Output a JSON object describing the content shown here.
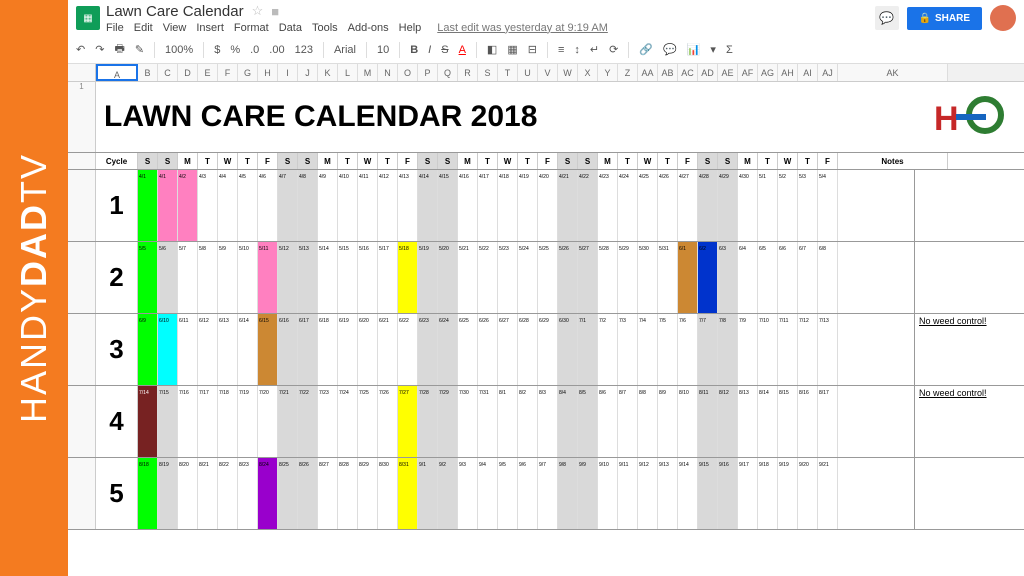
{
  "watermark": {
    "p1": "HANDY",
    "p2": "DAD",
    "p3": "TV"
  },
  "header": {
    "title": "Lawn Care Calendar",
    "menus": [
      "File",
      "Edit",
      "View",
      "Insert",
      "Format",
      "Data",
      "Tools",
      "Add-ons",
      "Help"
    ],
    "last_edit": "Last edit was yesterday at 9:19 AM",
    "share": "SHARE"
  },
  "toolbar": {
    "zoom": "100%",
    "currency": "$",
    "percent": "%",
    "dec0": ".0",
    "dec00": ".00",
    "fmt": "123",
    "font": "Arial",
    "size": "10"
  },
  "columns": [
    "A",
    "B",
    "C",
    "D",
    "E",
    "F",
    "G",
    "H",
    "I",
    "J",
    "K",
    "L",
    "M",
    "N",
    "O",
    "P",
    "Q",
    "R",
    "S",
    "T",
    "U",
    "V",
    "W",
    "X",
    "Y",
    "Z",
    "AA",
    "AB",
    "AC",
    "AD",
    "AE",
    "AF",
    "AG",
    "AH",
    "AI",
    "AJ",
    "AK"
  ],
  "sheet": {
    "title": "LAWN CARE CALENDAR 2018",
    "header_cycle": "Cycle",
    "header_days": [
      "S",
      "S",
      "M",
      "T",
      "W",
      "T",
      "F",
      "S",
      "S",
      "M",
      "T",
      "W",
      "T",
      "F",
      "S",
      "S",
      "M",
      "T",
      "W",
      "T",
      "F",
      "S",
      "S",
      "M",
      "T",
      "W",
      "T",
      "F",
      "S",
      "S",
      "M",
      "T",
      "W",
      "T",
      "F"
    ],
    "header_notes": "Notes",
    "weekend_cols": [
      0,
      1,
      7,
      8,
      14,
      15,
      21,
      22,
      28,
      29
    ],
    "cycles": [
      {
        "num": "1",
        "dates": [
          "4/1",
          "4/1",
          "4/2",
          "4/3",
          "4/4",
          "4/5",
          "4/6",
          "4/7",
          "4/8",
          "4/9",
          "4/10",
          "4/11",
          "4/12",
          "4/13",
          "4/14",
          "4/15",
          "4/16",
          "4/17",
          "4/18",
          "4/19",
          "4/20",
          "4/21",
          "4/22",
          "4/23",
          "4/24",
          "4/25",
          "4/26",
          "4/27",
          "4/28",
          "4/29",
          "4/30",
          "5/1",
          "5/2",
          "5/3",
          "5/4"
        ],
        "colors": {
          "0": "c-green",
          "1": "c-pink",
          "2": "c-pink"
        },
        "note": ""
      },
      {
        "num": "2",
        "dates": [
          "5/5",
          "5/6",
          "5/7",
          "5/8",
          "5/9",
          "5/10",
          "5/11",
          "5/12",
          "5/13",
          "5/14",
          "5/15",
          "5/16",
          "5/17",
          "5/18",
          "5/19",
          "5/20",
          "5/21",
          "5/22",
          "5/23",
          "5/24",
          "5/25",
          "5/26",
          "5/27",
          "5/28",
          "5/29",
          "5/30",
          "5/31",
          "6/1",
          "6/2",
          "6/3",
          "6/4",
          "6/5",
          "6/6",
          "6/7",
          "6/8"
        ],
        "colors": {
          "0": "c-green",
          "6": "c-pink",
          "13": "c-yellow",
          "27": "c-brown",
          "28": "c-blue"
        },
        "note": ""
      },
      {
        "num": "3",
        "dates": [
          "6/9",
          "6/10",
          "6/11",
          "6/12",
          "6/13",
          "6/14",
          "6/15",
          "6/16",
          "6/17",
          "6/18",
          "6/19",
          "6/20",
          "6/21",
          "6/22",
          "6/23",
          "6/24",
          "6/25",
          "6/26",
          "6/27",
          "6/28",
          "6/29",
          "6/30",
          "7/1",
          "7/2",
          "7/3",
          "7/4",
          "7/5",
          "7/6",
          "7/7",
          "7/8",
          "7/9",
          "7/10",
          "7/11",
          "7/12",
          "7/13"
        ],
        "colors": {
          "0": "c-green",
          "1": "c-cyan",
          "6": "c-brown"
        },
        "note": "No weed control!"
      },
      {
        "num": "4",
        "dates": [
          "7/14",
          "7/15",
          "7/16",
          "7/17",
          "7/18",
          "7/19",
          "7/20",
          "7/21",
          "7/22",
          "7/23",
          "7/24",
          "7/25",
          "7/26",
          "7/27",
          "7/28",
          "7/29",
          "7/30",
          "7/31",
          "8/1",
          "8/2",
          "8/3",
          "8/4",
          "8/5",
          "8/6",
          "8/7",
          "8/8",
          "8/9",
          "8/10",
          "8/11",
          "8/12",
          "8/13",
          "8/14",
          "8/15",
          "8/16",
          "8/17"
        ],
        "colors": {
          "0": "c-darkred",
          "13": "c-yellow"
        },
        "note": "No weed control!"
      },
      {
        "num": "5",
        "dates": [
          "8/18",
          "8/19",
          "8/20",
          "8/21",
          "8/22",
          "8/23",
          "8/24",
          "8/25",
          "8/26",
          "8/27",
          "8/28",
          "8/29",
          "8/30",
          "8/31",
          "9/1",
          "9/2",
          "9/3",
          "9/4",
          "9/5",
          "9/6",
          "9/7",
          "9/8",
          "9/9",
          "9/10",
          "9/11",
          "9/12",
          "9/13",
          "9/14",
          "9/15",
          "9/16",
          "9/17",
          "9/18",
          "9/19",
          "9/20",
          "9/21"
        ],
        "colors": {
          "0": "c-green",
          "6": "c-purple",
          "13": "c-yellow"
        },
        "note": ""
      }
    ]
  }
}
